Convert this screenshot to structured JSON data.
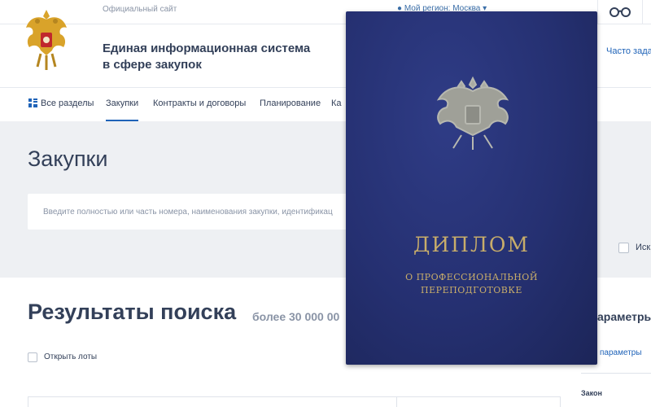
{
  "header": {
    "official_site": "Официальный сайт",
    "region": "Мой регион: Москва",
    "site_name_line1": "Единая информационная система",
    "site_name_line2": "в сфере закупок",
    "faq": "Часто зада"
  },
  "nav": {
    "items": [
      {
        "label": "Все разделы"
      },
      {
        "label": "Закупки"
      },
      {
        "label": "Контракты и договоры"
      },
      {
        "label": "Планирование"
      },
      {
        "label": "Ка"
      }
    ],
    "active": "Закупки"
  },
  "hero": {
    "title": "Закупки",
    "search_placeholder": "Введите полностью или часть номера, наименования закупки, идентификац",
    "right_checkbox_label": "Иск"
  },
  "results": {
    "title": "Результаты поиска",
    "count": "более 30 000 00",
    "open_lots_label": "Открыть лоты"
  },
  "params": {
    "title": "араметры",
    "link": "параметры",
    "law_label": "Закон"
  },
  "diploma": {
    "title": "ДИПЛОМ",
    "subtitle_line1": "О ПРОФЕССИОНАЛЬНОЙ",
    "subtitle_line2": "ПЕРЕПОДГОТОВКЕ",
    "cover_color": "#253071",
    "foil_color": "#c8ad6a"
  },
  "colors": {
    "accent": "#1f63b8",
    "text": "#334059",
    "muted": "#8a94a6",
    "hero_bg": "#eef0f3"
  }
}
